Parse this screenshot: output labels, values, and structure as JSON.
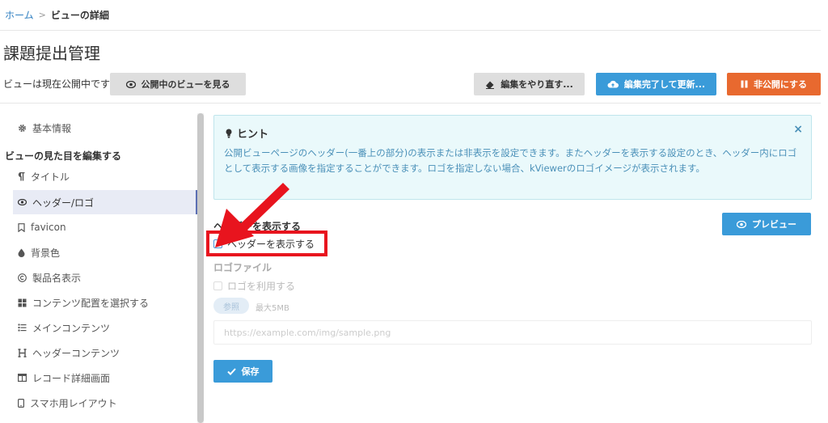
{
  "breadcrumb": {
    "home": "ホーム",
    "current": "ビューの詳細"
  },
  "page": {
    "title": "課題提出管理"
  },
  "status": {
    "text": "ビューは現在公開中です",
    "view_button": "公開中のビューを見る"
  },
  "toolbar": {
    "redo_edit": "編集をやり直す...",
    "finish_update": "編集完了して更新...",
    "unpublish": "非公開にする"
  },
  "sidebar": {
    "basic_info": "基本情報",
    "section_heading": "ビューの見た目を編集する",
    "items": [
      {
        "label": "タイトル",
        "icon": "paragraph-icon"
      },
      {
        "label": "ヘッダー/ロゴ",
        "icon": "eye-icon",
        "active": true
      },
      {
        "label": "favicon",
        "icon": "bookmark-icon"
      },
      {
        "label": "背景色",
        "icon": "droplet-icon"
      },
      {
        "label": "製品名表示",
        "icon": "copyright-icon"
      },
      {
        "label": "コンテンツ配置を選択する",
        "icon": "grid-icon"
      },
      {
        "label": "メインコンテンツ",
        "icon": "list-icon"
      },
      {
        "label": "ヘッダーコンテンツ",
        "icon": "heading-icon"
      },
      {
        "label": "レコード詳細画面",
        "icon": "table-icon"
      },
      {
        "label": "スマホ用レイアウト",
        "icon": "mobile-icon"
      }
    ]
  },
  "hint": {
    "title": "ヒント",
    "body": "公開ビューページのヘッダー(一番上の部分)の表示または非表示を設定できます。またヘッダーを表示する設定のとき、ヘッダー内にロゴとして表示する画像を指定することができます。ロゴを指定しない場合、kViewerのロゴイメージが表示されます。",
    "close": "×"
  },
  "header_section": {
    "label": "ヘッダーを表示する",
    "checkbox_label": "ヘッダーを表示する",
    "preview_button": "プレビュー"
  },
  "logo_section": {
    "label": "ロゴファイル",
    "checkbox_label": "ロゴを利用する",
    "browse_button": "参照",
    "max_size": "最大5MB",
    "url_placeholder": "https://example.com/img/sample.png"
  },
  "save_button": "保存",
  "colors": {
    "primary_blue": "#3a9bd9",
    "orange": "#e8692f",
    "highlight_red": "#e8141e",
    "hint_bg": "#eaf9fb"
  }
}
